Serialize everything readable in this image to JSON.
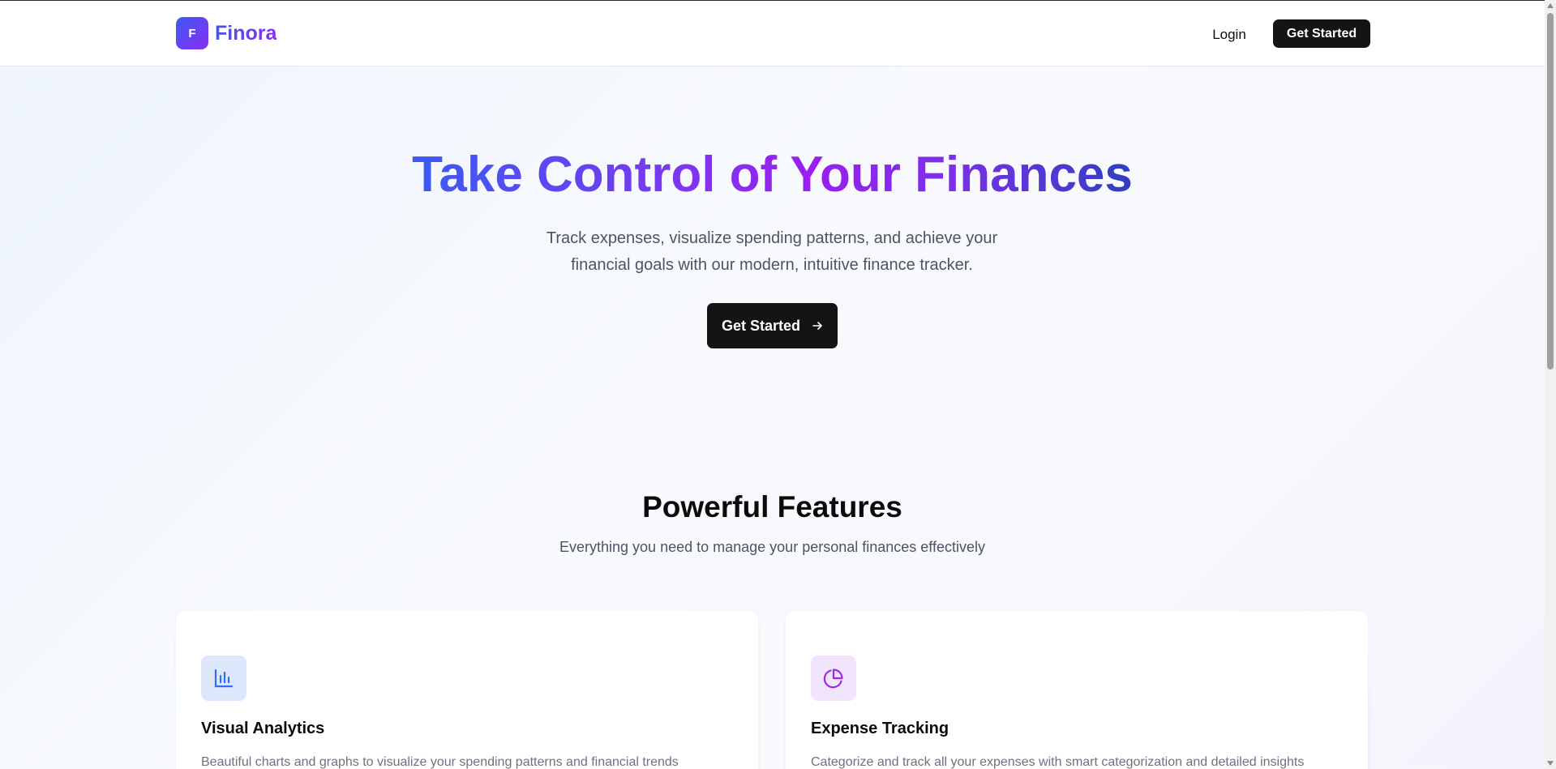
{
  "header": {
    "brand_initial": "F",
    "brand_name": "Finora",
    "login_label": "Login",
    "cta_label": "Get Started"
  },
  "hero": {
    "title": "Take Control of Your Finances",
    "subtitle": "Track expenses, visualize spending patterns, and achieve your financial goals with our modern, intuitive finance tracker.",
    "cta_label": "Get Started",
    "cta_icon": "arrow-right-icon"
  },
  "features": {
    "title": "Powerful Features",
    "subtitle": "Everything you need to manage your personal finances effectively",
    "cards": [
      {
        "icon": "bar-chart-icon",
        "title": "Visual Analytics",
        "description": "Beautiful charts and graphs to visualize your spending patterns and financial trends"
      },
      {
        "icon": "pie-chart-icon",
        "title": "Expense Tracking",
        "description": "Categorize and track all your expenses with smart categorization and detailed insights"
      }
    ]
  },
  "colors": {
    "brand_gradient_start": "#3b5bf6",
    "brand_gradient_end": "#8b2cf0",
    "button_dark": "#141414",
    "muted_text": "#4b5563",
    "analytics_icon": "#2f6ff5",
    "tracking_icon": "#9a2be6"
  }
}
